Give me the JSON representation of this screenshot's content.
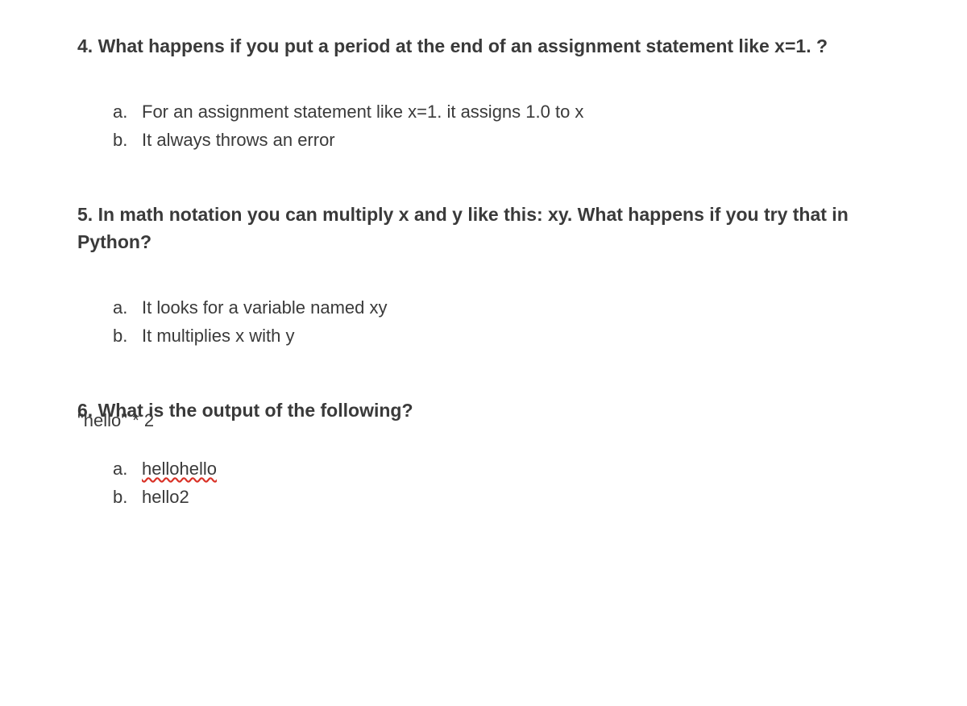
{
  "questions": [
    {
      "title": "4. What happens if you put a period at the end of an assignment statement like x=1. ?",
      "options": [
        {
          "marker": "a.",
          "text": "For an assignment statement like x=1. it assigns 1.0 to x"
        },
        {
          "marker": "b.",
          "text": "It always throws an error"
        }
      ]
    },
    {
      "title": "5. In math notation you can multiply x and y like this: xy. What happens if you try that in Python?",
      "options": [
        {
          "marker": "a.",
          "text": "It looks for a variable named xy"
        },
        {
          "marker": "b.",
          "text": "It multiplies x with y"
        }
      ]
    },
    {
      "title": "6. What is the output of the following?",
      "subtext": "\"hello\" * 2",
      "options": [
        {
          "marker": "a.",
          "text": "hellohello",
          "spellcheck": true
        },
        {
          "marker": "b.",
          "text": "hello2"
        }
      ]
    }
  ]
}
